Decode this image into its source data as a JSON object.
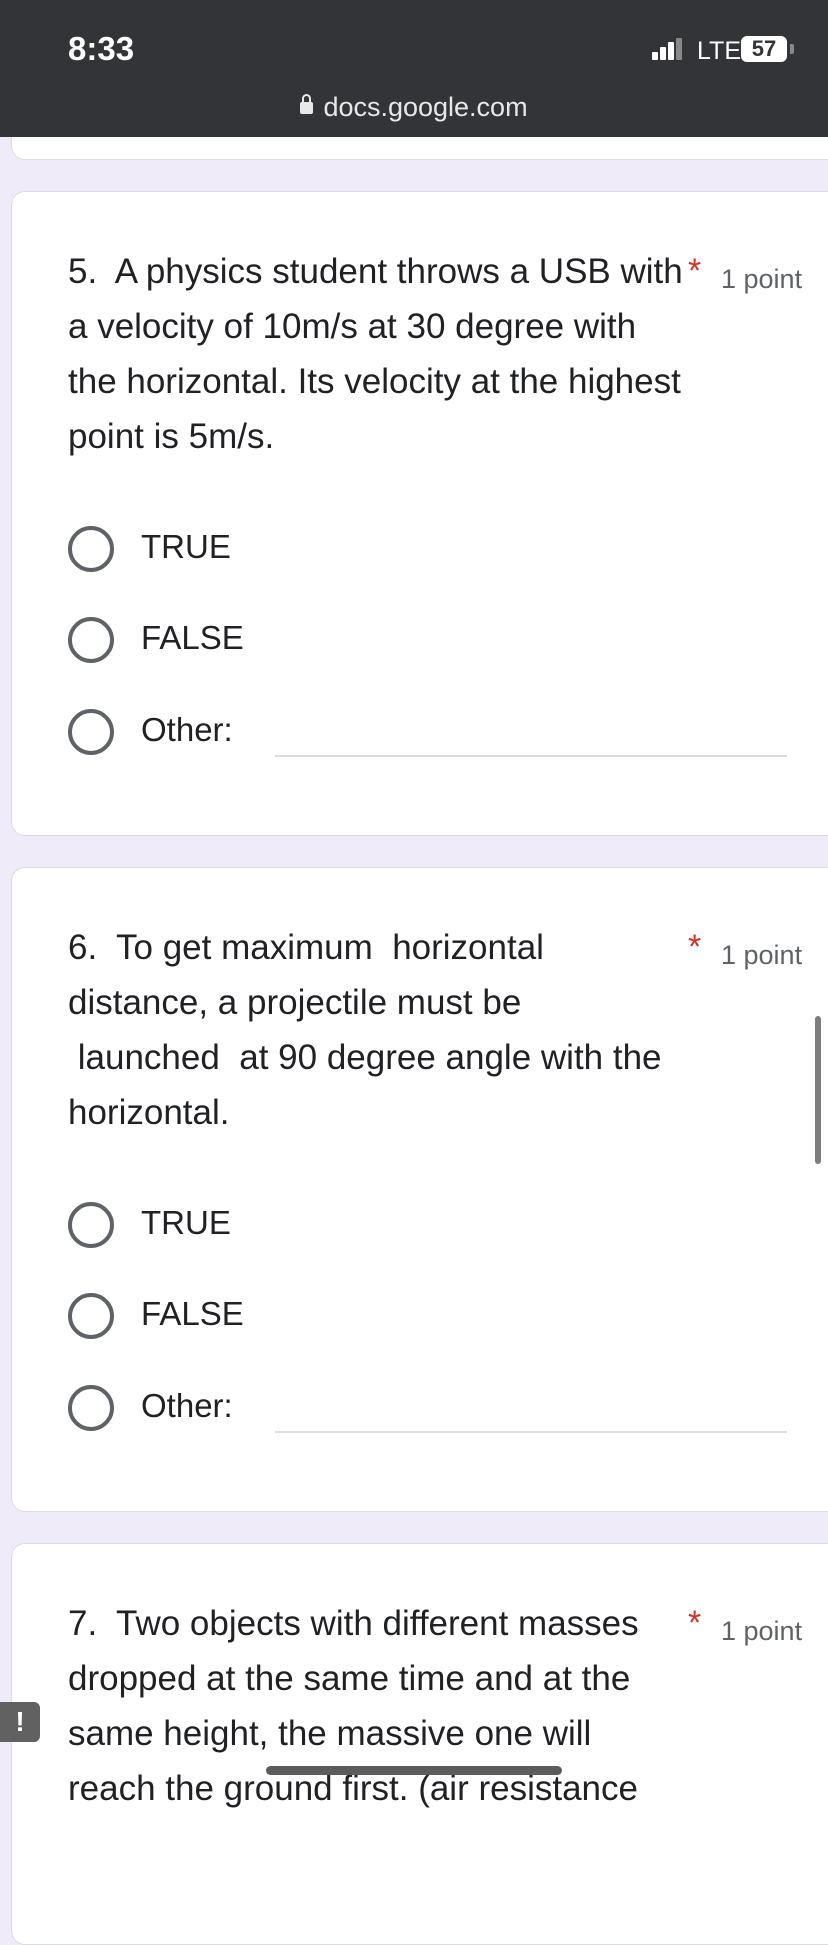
{
  "status_bar": {
    "time": "8:33",
    "network": "LTE",
    "battery": "57"
  },
  "browser": {
    "url": "docs.google.com"
  },
  "questions": [
    {
      "text": "5.  A physics student throws a USB with a velocity of 10m/s at 30 degree with the horizontal. Its velocity at the highest point is 5m/s.",
      "required_mark": "*",
      "points": "1 point",
      "options": [
        "TRUE",
        "FALSE",
        "Other:"
      ]
    },
    {
      "text": "6.  To get maximum  horizontal distance, a projectile must be\n launched  at 90 degree angle with the horizontal.",
      "required_mark": "*",
      "points": "1 point",
      "options": [
        "TRUE",
        "FALSE",
        "Other:"
      ]
    },
    {
      "text": "7.  Two objects with different masses dropped at the same time and at the same height, the massive one will reach the ground first. (air resistance",
      "required_mark": "*",
      "points": "1 point"
    }
  ],
  "feedback": {
    "label": "!"
  }
}
